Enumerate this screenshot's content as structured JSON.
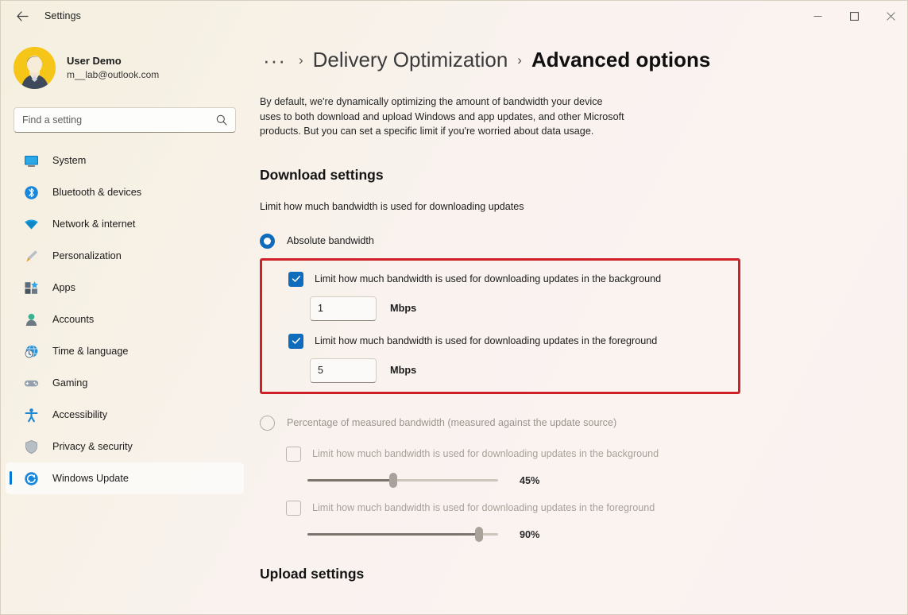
{
  "window": {
    "title": "Settings",
    "back_icon": "back-arrow-icon",
    "minimize_label": "–",
    "maximize_label": "□",
    "close_label": "×"
  },
  "account": {
    "name": "User Demo",
    "email": "m__lab@outlook.com",
    "avatar_color": "#f5c518"
  },
  "search": {
    "placeholder": "Find a setting",
    "value": "",
    "icon": "search-icon"
  },
  "sidebar": {
    "items": [
      {
        "label": "System",
        "icon": "monitor-icon",
        "selected": false
      },
      {
        "label": "Bluetooth & devices",
        "icon": "bluetooth-icon",
        "selected": false
      },
      {
        "label": "Network & internet",
        "icon": "wifi-icon",
        "selected": false
      },
      {
        "label": "Personalization",
        "icon": "paintbrush-icon",
        "selected": false
      },
      {
        "label": "Apps",
        "icon": "apps-grid-icon",
        "selected": false
      },
      {
        "label": "Accounts",
        "icon": "person-icon",
        "selected": false
      },
      {
        "label": "Time & language",
        "icon": "clock-globe-icon",
        "selected": false
      },
      {
        "label": "Gaming",
        "icon": "gamepad-icon",
        "selected": false
      },
      {
        "label": "Accessibility",
        "icon": "accessibility-person-icon",
        "selected": false
      },
      {
        "label": "Privacy & security",
        "icon": "shield-icon",
        "selected": false
      },
      {
        "label": "Windows Update",
        "icon": "update-refresh-icon",
        "selected": true
      }
    ],
    "accent_color": "#0078d4"
  },
  "breadcrumb": {
    "overflow": "···",
    "separator": "›",
    "parent": "Delivery Optimization",
    "current": "Advanced options"
  },
  "main": {
    "intro": "By default, we're dynamically optimizing the amount of bandwidth your device uses to both download and upload Windows and app updates, and other Microsoft products. But you can set a specific limit if you're worried about data usage.",
    "download": {
      "title": "Download settings",
      "subtitle": "Limit how much bandwidth is used for downloading updates",
      "absolute": {
        "radio_label": "Absolute bandwidth",
        "selected": true,
        "highlight_color": "#cf2028",
        "background": {
          "checkbox_label": "Limit how much bandwidth is used for downloading updates in the background",
          "checked": true,
          "value": "1",
          "unit": "Mbps"
        },
        "foreground": {
          "checkbox_label": "Limit how much bandwidth is used for downloading updates in the foreground",
          "checked": true,
          "value": "5",
          "unit": "Mbps"
        }
      },
      "percentage": {
        "radio_label": "Percentage of measured bandwidth (measured against the update source)",
        "selected": false,
        "background": {
          "checkbox_label": "Limit how much bandwidth is used for downloading updates in the background",
          "checked": false,
          "value": "45%",
          "percent": 45
        },
        "foreground": {
          "checkbox_label": "Limit how much bandwidth is used for downloading updates in the foreground",
          "checked": false,
          "value": "90%",
          "percent": 90
        }
      }
    },
    "upload": {
      "title": "Upload settings"
    }
  }
}
